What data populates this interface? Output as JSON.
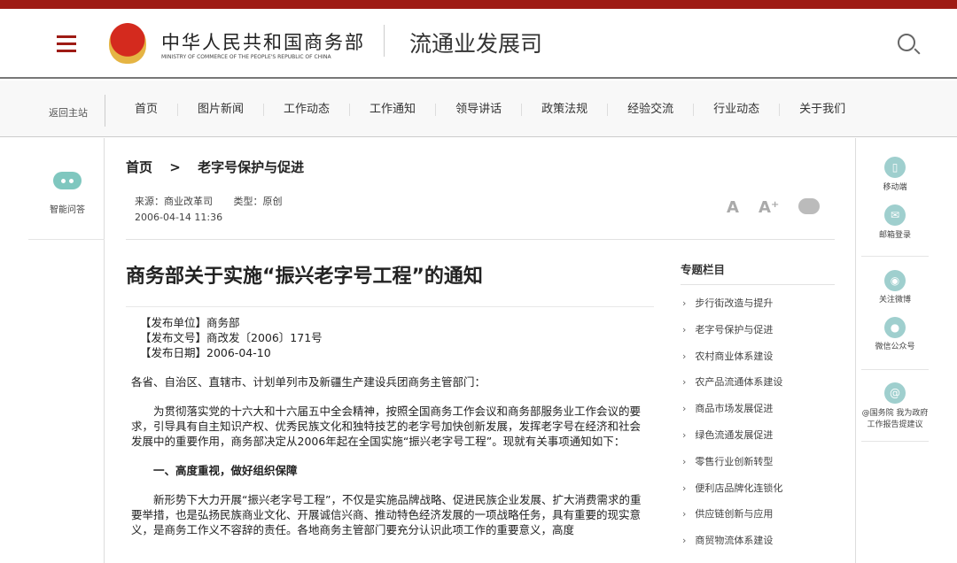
{
  "header": {
    "ministry": "中华人民共和国商务部",
    "ministry_en": "MINISTRY OF COMMERCE OF THE PEOPLE'S REPUBLIC OF CHINA",
    "department": "流通业发展司",
    "brand_color": "#9e1b14"
  },
  "nav": {
    "back": "返回主站",
    "items": [
      "首页",
      "图片新闻",
      "工作动态",
      "工作通知",
      "领导讲话",
      "政策法规",
      "经验交流",
      "行业动态",
      "关于我们"
    ]
  },
  "left_sidebar": {
    "assistant": "智能问答"
  },
  "breadcrumb": {
    "home": "首页",
    "sep": ">",
    "current": "老字号保护与促进"
  },
  "meta": {
    "source": "来源：商业改革司",
    "type": "类型：原创",
    "datetime": "2006-04-14 11:36"
  },
  "tools": {
    "font_smaller": "A",
    "font_larger": "A⁺"
  },
  "article": {
    "title": "商务部关于实施“振兴老字号工程”的通知",
    "fields": [
      "【发布单位】商务部",
      "【发布文号】商改发〔2006〕171号",
      "【发布日期】2006-04-10"
    ],
    "addressee": "各省、自治区、直辖市、计划单列市及新疆生产建设兵团商务主管部门：",
    "p1": "为贯彻落实党的十六大和十六届五中全会精神，按照全国商务工作会议和商务部服务业工作会议的要求，引导具有自主知识产权、优秀民族文化和独特技艺的老字号加快创新发展，发挥老字号在经济和社会发展中的重要作用，商务部决定从2006年起在全国实施“振兴老字号工程”。现就有关事项通知如下：",
    "h1": "一、高度重视，做好组织保障",
    "p2": "新形势下大力开展“振兴老字号工程”，不仅是实施品牌战略、促进民族企业发展、扩大消费需求的重要举措，也是弘扬民族商业文化、开展诚信兴商、推动特色经济发展的一项战略任务，具有重要的现实意义，是商务工作义不容辞的责任。各地商务主管部门要充分认识此项工作的重要意义，高度"
  },
  "topics": {
    "title": "专题栏目",
    "items": [
      "步行街改造与提升",
      "老字号保护与促进",
      "农村商业体系建设",
      "农产品流通体系建设",
      "商品市场发展促进",
      "绿色流通发展促进",
      "零售行业创新转型",
      "便利店品牌化连锁化",
      "供应链创新与应用",
      "商贸物流体系建设"
    ]
  },
  "right_sidebar": {
    "mobile": "移动端",
    "mail": "邮箱登录",
    "weibo": "关注微博",
    "wechat": "微信公众号",
    "suggest": "@国务院 我为政府工作报告提建议"
  }
}
